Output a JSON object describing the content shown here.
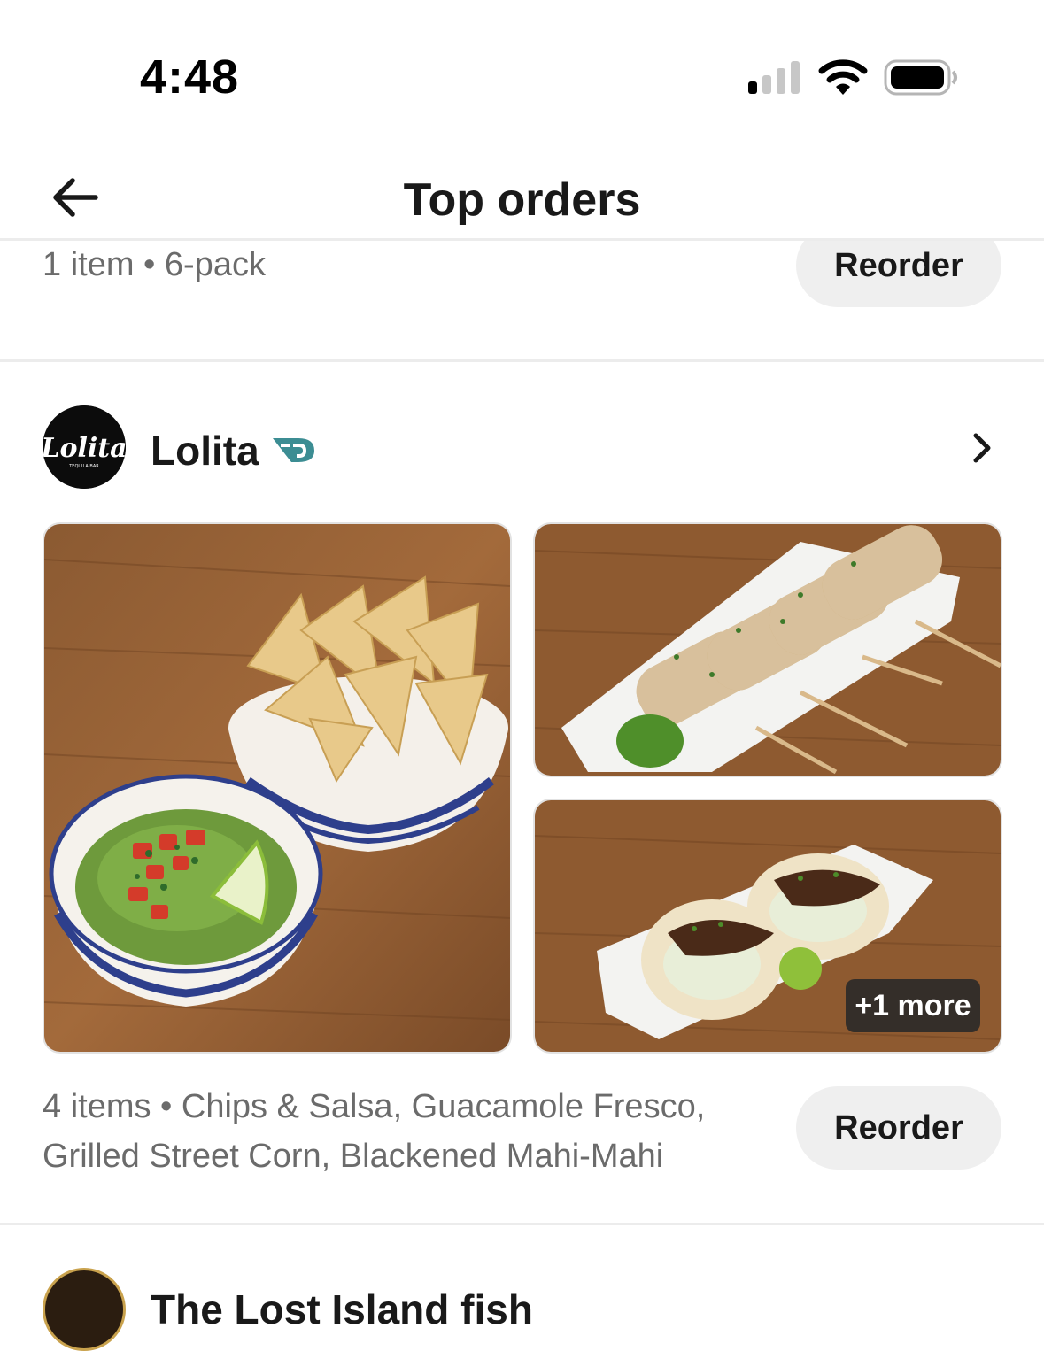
{
  "status_bar": {
    "time": "4:48",
    "icons": [
      "signal-icon",
      "wifi-icon",
      "battery-icon"
    ]
  },
  "header": {
    "title": "Top orders",
    "back_icon": "arrow-left-icon"
  },
  "previous_order": {
    "summary": "1 item • 6-pack",
    "reorder_label": "Reorder"
  },
  "store": {
    "name": "Lolita",
    "logo_text": "Lolita",
    "logo_subtext": "TEQUILA BAR",
    "badge_icon": "dashpass-icon",
    "chevron_icon": "chevron-right-icon",
    "images": [
      {
        "name": "guacamole-chips-image",
        "description": "Chips & Salsa, Guacamole Fresco"
      },
      {
        "name": "street-corn-image",
        "description": "Grilled Street Corn"
      },
      {
        "name": "mahi-mahi-tacos-image",
        "description": "Blackened Mahi-Mahi"
      }
    ],
    "more_badge": "+1 more",
    "order_summary": "4 items • Chips & Salsa, Guacamole Fresco, Grilled Street Corn, Blackened Mahi-Mahi",
    "reorder_label": "Reorder"
  },
  "next_store": {
    "name_partial": "The Lost Island fish"
  },
  "colors": {
    "text_primary": "#191919",
    "text_secondary": "#6b6b6b",
    "button_bg": "#efefef",
    "dashpass": "#3c8d93",
    "divider": "#ececec"
  }
}
